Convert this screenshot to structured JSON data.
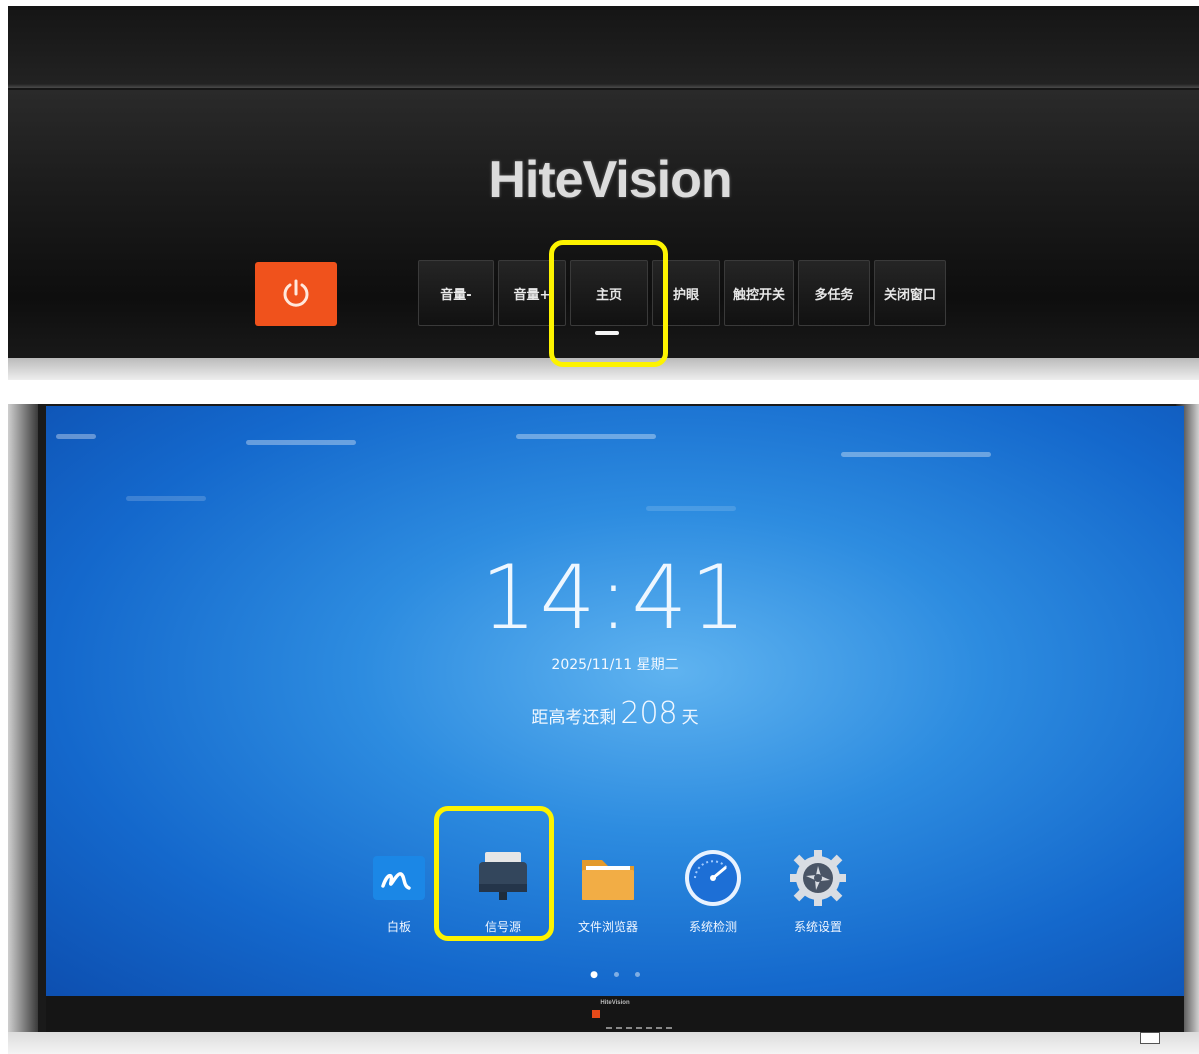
{
  "panel": {
    "brand": "HiteVision",
    "buttons": {
      "vol_down": "音量-",
      "vol_up": "音量+",
      "home": "主页",
      "eye_care": "护眼",
      "touch_toggle": "触控开关",
      "multitask": "多任务",
      "close_window": "关闭窗口"
    }
  },
  "screen": {
    "time": "14:41",
    "date": "2025/11/11  星期二",
    "countdown": {
      "prefix": "距高考还剩",
      "days": "208",
      "suffix": "天"
    },
    "apps": {
      "whiteboard": "白板",
      "signal_source": "信号源",
      "file_browser": "文件浏览器",
      "system_check": "系统检测",
      "system_settings": "系统设置"
    },
    "bezel_brand": "HiteVision"
  },
  "colors": {
    "highlight": "#fdf300",
    "power": "#f0521c",
    "screen_blue": "#2d8ce0"
  }
}
